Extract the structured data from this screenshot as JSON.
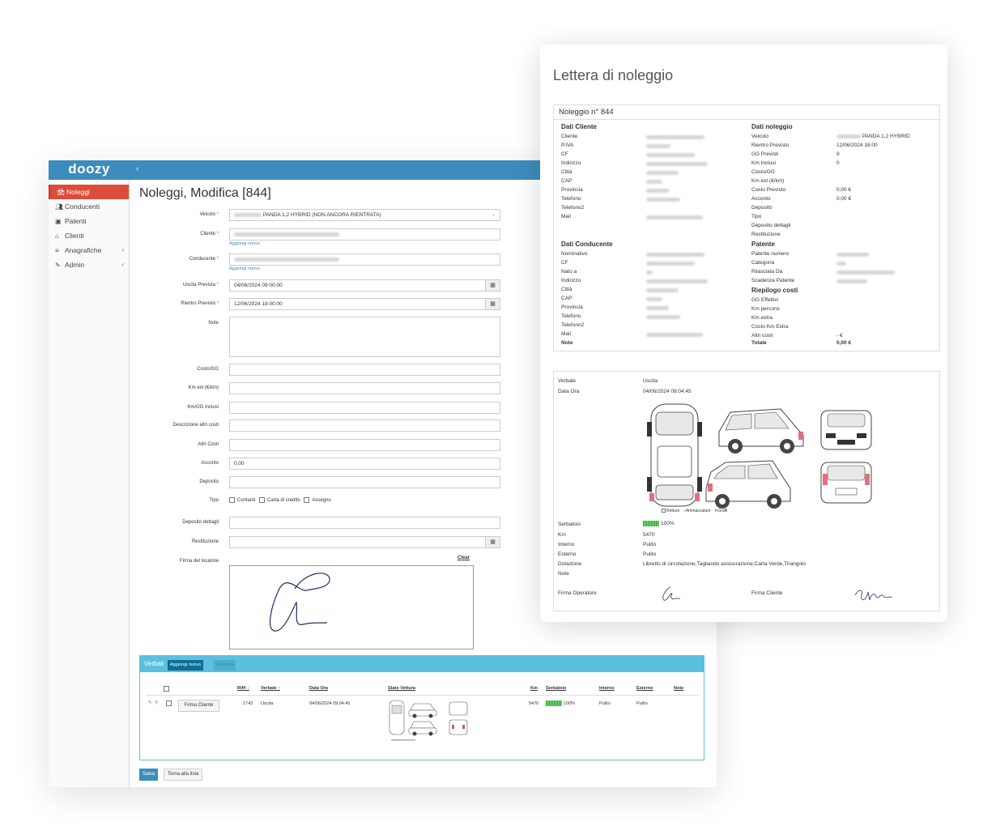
{
  "app": {
    "logo": "doozy",
    "sidebar": [
      {
        "label": "Noleggi",
        "icon": "car-icon",
        "active": true
      },
      {
        "label": "Conducenti",
        "icon": "users-icon"
      },
      {
        "label": "Patenti",
        "icon": "id-card-icon"
      },
      {
        "label": "Clienti",
        "icon": "bank-icon"
      },
      {
        "label": "Anagrafiche",
        "icon": "list-icon",
        "has_submenu": true
      },
      {
        "label": "Admin",
        "icon": "wrench-icon",
        "has_submenu": true
      }
    ],
    "page_title": "Noleggi, Modifica [844]",
    "form": {
      "veicolo_label": "Veicolo",
      "veicolo_value": "PANDA 1,2 HYBRID (NON ANCORA RIENTRATA)",
      "cliente_label": "Cliente",
      "add_new": "Aggiungi nuovo",
      "conducente_label": "Conducente",
      "uscita_label": "Uscita Prevista",
      "uscita_value": "04/06/2024 09:00:00",
      "rientro_label": "Rientro Previsto",
      "rientro_value": "12/06/2024 18:00:00",
      "note_label": "Note",
      "costo_gg_label": "Costo/GG",
      "km_ext_label": "Km ext (€/km)",
      "km_gg_label": "Km/GG Inclusi",
      "descr_costi_label": "Descrizione altri costi",
      "altri_costi_label": "Altri Costi",
      "acconto_label": "Acconto",
      "acconto_value": "0,00",
      "deposito_label": "Deposito",
      "tipo_label": "Tipo",
      "tipo_options": [
        "Contanti",
        "Carta di credito",
        "Assegno"
      ],
      "deposito_dettagli_label": "Deposito dettagli",
      "restituzione_label": "Restituzione",
      "firma_label": "Firma del locatore",
      "clear_label": "Clear"
    },
    "verbali": {
      "title": "Verbali",
      "add_button": "Aggiungi nuovo",
      "delete_button": "Cancella",
      "columns": [
        "Rif# ↓",
        "Verbale ↑",
        "Data Ora",
        "Stato Vettura",
        "Km",
        "Serbatoio",
        "Interno",
        "Esterno",
        "Note"
      ],
      "row": {
        "sign_button": "Firma Cliente",
        "rif": "1743",
        "verbale": "Uscita",
        "data_ora": "04/06/2024 09:04:45",
        "km": "5470",
        "serbatoio": "100%",
        "interno": "Pulito",
        "esterno": "Pulito"
      }
    },
    "save_button": "Salva",
    "back_button": "Torna alla lista"
  },
  "letter": {
    "title": "Lettera di noleggio",
    "noleggio_header": "Noleggio n° 844",
    "dati_cliente_title": "Dati Cliente",
    "dati_cliente_labels": [
      "Cliente",
      "P.IVA",
      "CF",
      "Indirizzo",
      "Città",
      "CAP",
      "Provincia",
      "Telefono",
      "Telefono2",
      "Mail"
    ],
    "dati_noleggio_title": "Dati noleggio",
    "dati_noleggio": [
      {
        "label": "Veicolo",
        "value": "PANDA 1,2 HYBRID"
      },
      {
        "label": "Rientro Previsto",
        "value": "12/06/2024 18:00"
      },
      {
        "label": "GG Previsti",
        "value": "9"
      },
      {
        "label": "Km Inclusi",
        "value": "0"
      },
      {
        "label": "Costo/GG",
        "value": ""
      },
      {
        "label": "Km ext (€/km)",
        "value": ""
      },
      {
        "label": "Costo Previsto",
        "value": "0,00 €"
      },
      {
        "label": "Acconto",
        "value": "0,00 €"
      },
      {
        "label": "Deposito",
        "value": ""
      },
      {
        "label": "Tipo",
        "value": ""
      },
      {
        "label": "Deposito dettagli",
        "value": ""
      },
      {
        "label": "Restituzione",
        "value": ""
      }
    ],
    "dati_conducente_title": "Dati Conducente",
    "dati_conducente_labels": [
      "Nominativo",
      "CF",
      "Nato a",
      "Indirizzo",
      "Città",
      "CAP",
      "Provincia",
      "Telefono",
      "Telefono2",
      "Mail"
    ],
    "note_label": "Note",
    "patente_title": "Patente",
    "patente_labels": [
      "Patente numero",
      "Categoria",
      "Rilasciata Da",
      "Scadenza Patente"
    ],
    "riepilogo_title": "Riepilogo costi",
    "riepilogo": [
      {
        "label": "GG Effettivi",
        "value": ""
      },
      {
        "label": "Km percorsi",
        "value": ""
      },
      {
        "label": "Km extra",
        "value": ""
      },
      {
        "label": "Costo Km Extra",
        "value": ""
      },
      {
        "label": "Altri costi",
        "value": "- €"
      }
    ],
    "totale_label": "Totale",
    "totale_value": "0,00 €",
    "verbale": {
      "verbale_label": "Verbale",
      "verbale_value": "Uscita",
      "data_label": "Data Ora",
      "data_value": "04/06/2024 09:04:45",
      "legend": [
        "Rotture",
        "Ammaccature",
        "Graffi"
      ],
      "serbatoio_label": "Serbatoio",
      "serbatoio_value": "100%",
      "km_label": "Km",
      "km_value": "5470",
      "interno_label": "Interno",
      "interno_value": "Pulito",
      "esterno_label": "Esterno",
      "esterno_value": "Pulito",
      "dotazione_label": "Dotazione",
      "dotazione_value": "Libretto di circolazione,Tagliando assicurazione,Carta Verde,Triangolo",
      "note_label": "Note",
      "firma_operatore_label": "Firma Operatore",
      "firma_cliente_label": "Firma Cliente"
    }
  }
}
